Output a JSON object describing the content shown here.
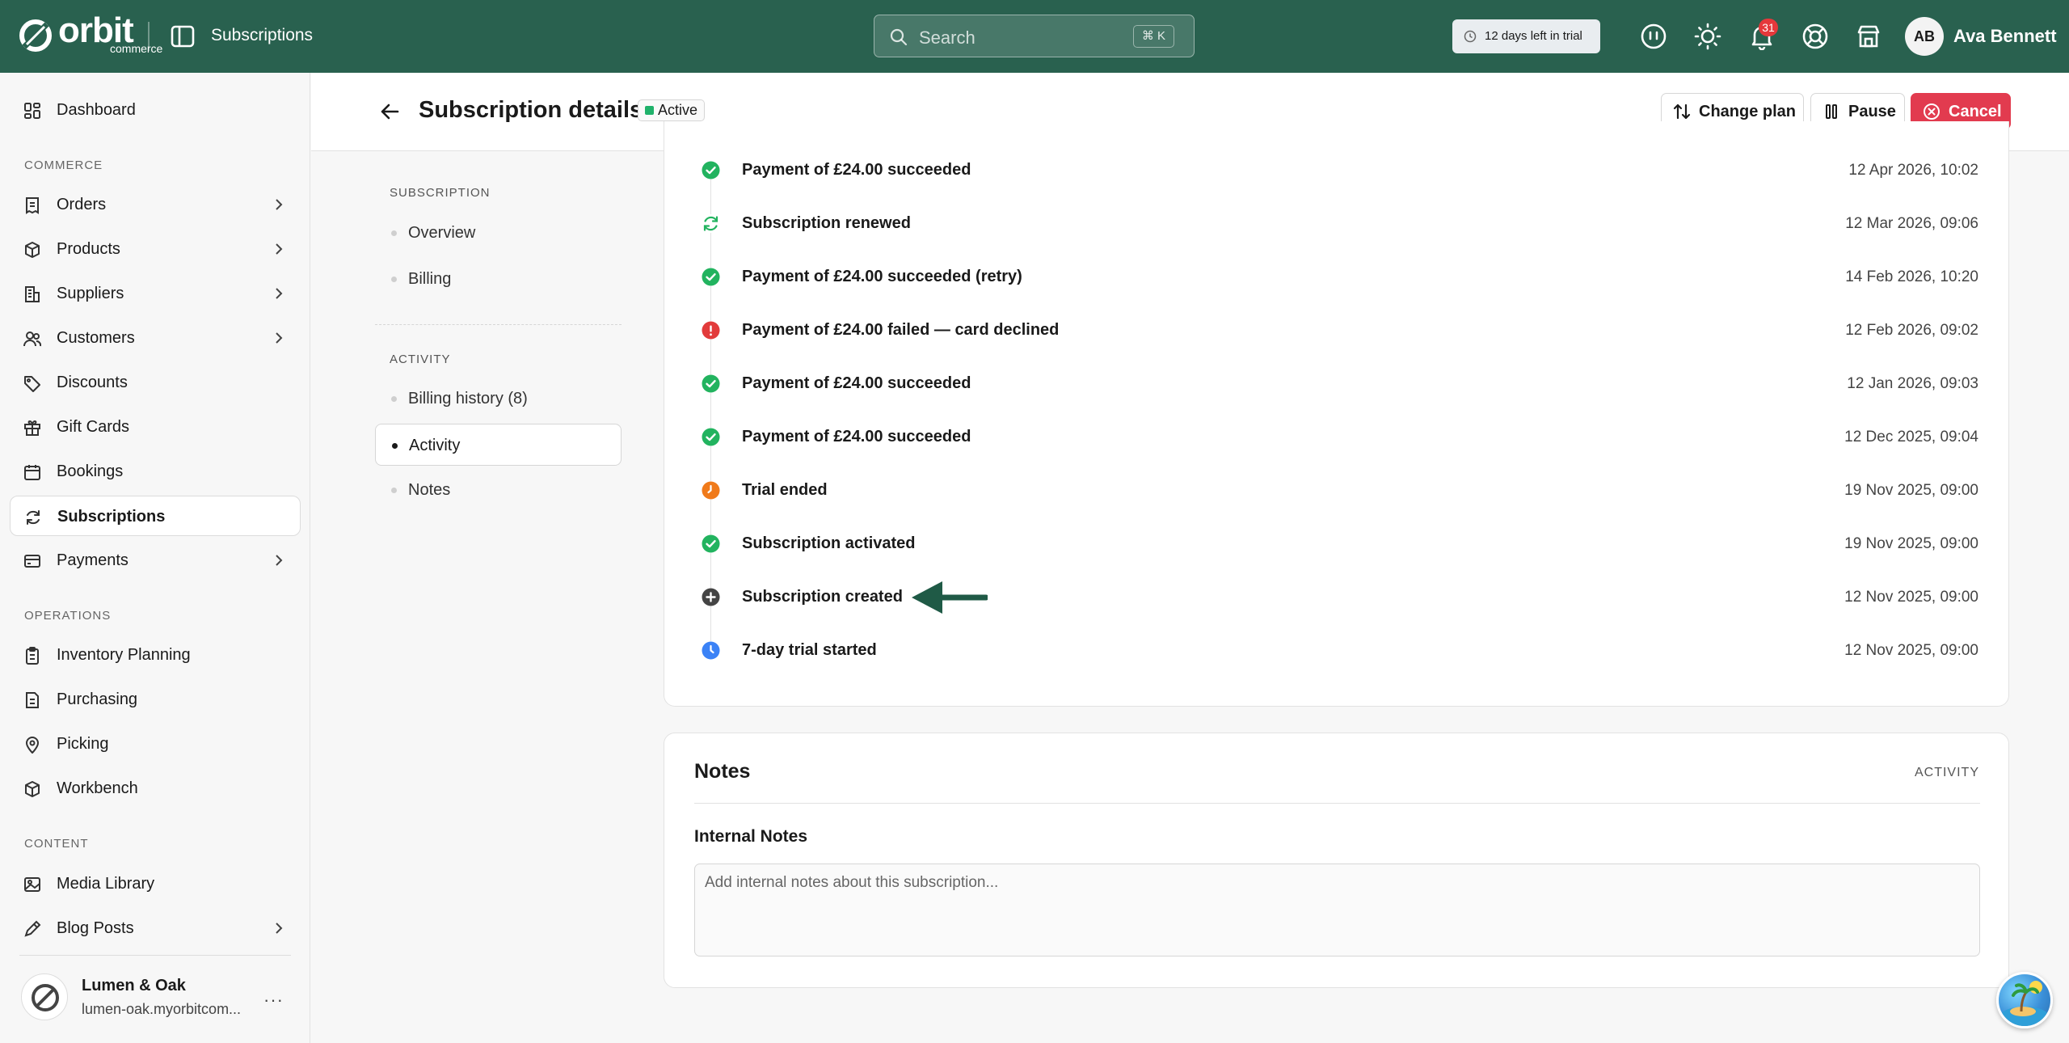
{
  "topbar": {
    "logo_text": "orbit",
    "logo_sub": "commerce",
    "title": "Subscriptions",
    "search_placeholder": "Search",
    "search_shortcut": "⌘ K",
    "trial_label": "12 days left in trial",
    "notification_count": "31",
    "user_initials": "AB",
    "user_name": "Ava Bennett"
  },
  "sidebar": {
    "dashboard": "Dashboard",
    "section_commerce": "COMMERCE",
    "orders": "Orders",
    "products": "Products",
    "suppliers": "Suppliers",
    "customers": "Customers",
    "discounts": "Discounts",
    "gift_cards": "Gift Cards",
    "bookings": "Bookings",
    "subscriptions": "Subscriptions",
    "payments": "Payments",
    "section_operations": "OPERATIONS",
    "inventory_planning": "Inventory Planning",
    "purchasing": "Purchasing",
    "picking": "Picking",
    "workbench": "Workbench",
    "section_content": "CONTENT",
    "media_library": "Media Library",
    "blog_posts": "Blog Posts",
    "store_name": "Lumen & Oak",
    "store_url": "lumen-oak.myorbitcom...",
    "store_more": "···"
  },
  "header": {
    "title": "Subscription details",
    "status": "Active",
    "change_plan": "Change plan",
    "pause": "Pause",
    "cancel": "Cancel"
  },
  "section_nav": {
    "subscription_heading": "SUBSCRIPTION",
    "overview": "Overview",
    "billing": "Billing",
    "activity_heading": "ACTIVITY",
    "billing_history": "Billing history (8)",
    "activity": "Activity",
    "notes": "Notes"
  },
  "activity": {
    "events": [
      {
        "title": "Payment of £24.00 succeeded",
        "time": "12 Apr 2026, 10:02",
        "kind": "success"
      },
      {
        "title": "Subscription renewed",
        "time": "12 Mar 2026, 09:06",
        "kind": "renewed"
      },
      {
        "title": "Payment of £24.00 succeeded (retry)",
        "time": "14 Feb 2026, 10:20",
        "kind": "success"
      },
      {
        "title": "Payment of £24.00 failed — card declined",
        "time": "12 Feb 2026, 09:02",
        "kind": "failed"
      },
      {
        "title": "Payment of £24.00 succeeded",
        "time": "12 Jan 2026, 09:03",
        "kind": "success"
      },
      {
        "title": "Payment of £24.00 succeeded",
        "time": "12 Dec 2025, 09:04",
        "kind": "success"
      },
      {
        "title": "Trial ended",
        "time": "19 Nov 2025, 09:00",
        "kind": "trial-ended"
      },
      {
        "title": "Subscription activated",
        "time": "19 Nov 2025, 09:00",
        "kind": "success"
      },
      {
        "title": "Subscription created",
        "time": "12 Nov 2025, 09:00",
        "kind": "created"
      },
      {
        "title": "7-day trial started",
        "time": "12 Nov 2025, 09:00",
        "kind": "trial-started"
      }
    ]
  },
  "notes": {
    "title": "Notes",
    "tag": "ACTIVITY",
    "internal_label": "Internal Notes",
    "placeholder": "Add internal notes about this subscription...",
    "value": ""
  },
  "colors": {
    "topbar": "#29614f",
    "success": "#22b35f",
    "failed": "#e23b3b",
    "trial_ended": "#f07a1a",
    "trial_started": "#3b82f6",
    "created": "#444444",
    "cancel_button": "#e23b4f",
    "arrow": "#1f5a46"
  }
}
